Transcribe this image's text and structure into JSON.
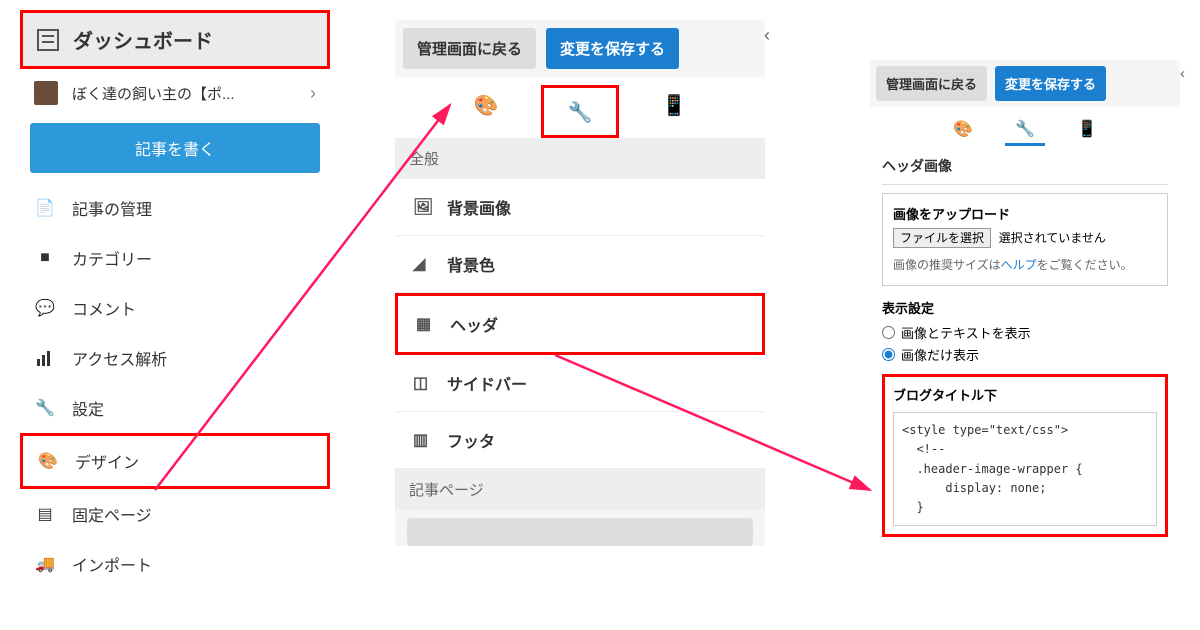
{
  "panel1": {
    "dashboard": "ダッシュボード",
    "blog_name": "ぼく達の飼い主の【ポ...",
    "write_post": "記事を書く",
    "items": [
      {
        "icon": "file",
        "label": "記事の管理"
      },
      {
        "icon": "folder",
        "label": "カテゴリー"
      },
      {
        "icon": "comment",
        "label": "コメント"
      },
      {
        "icon": "chart",
        "label": "アクセス解析"
      },
      {
        "icon": "wrench",
        "label": "設定"
      },
      {
        "icon": "palette",
        "label": "デザイン"
      },
      {
        "icon": "pages",
        "label": "固定ページ"
      },
      {
        "icon": "import",
        "label": "インポート"
      }
    ]
  },
  "panel2": {
    "back_btn": "管理画面に戻る",
    "save_btn": "変更を保存する",
    "general": "全般",
    "items": [
      {
        "icon": "image",
        "label": "背景画像"
      },
      {
        "icon": "paint",
        "label": "背景色"
      },
      {
        "icon": "header",
        "label": "ヘッダ"
      },
      {
        "icon": "sidebar",
        "label": "サイドバー"
      },
      {
        "icon": "footer",
        "label": "フッタ"
      }
    ],
    "article_page": "記事ページ"
  },
  "panel3": {
    "back_btn": "管理画面に戻る",
    "save_btn": "変更を保存する",
    "header_image": "ヘッダ画像",
    "upload_label": "画像をアップロード",
    "file_btn": "ファイルを選択",
    "file_none": "選択されていません",
    "help_text1": "画像の推奨サイズは",
    "help_link": "ヘルプ",
    "help_text2": "をご覧ください。",
    "display_title": "表示設定",
    "radio1": "画像とテキストを表示",
    "radio2": "画像だけ表示",
    "code_title": "ブログタイトル下",
    "code": "<style type=\"text/css\">\n  <!--\n  .header-image-wrapper {\n      display: none;\n  }"
  }
}
